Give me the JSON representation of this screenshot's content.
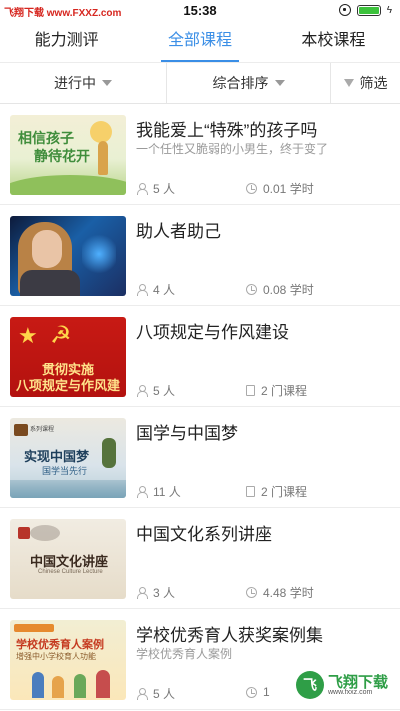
{
  "status_bar": {
    "watermark": "飞翔下载 www.FXXZ.com",
    "time": "15:38"
  },
  "tabs": [
    {
      "label": "能力测评",
      "active": false
    },
    {
      "label": "全部课程",
      "active": true
    },
    {
      "label": "本校课程",
      "active": false
    }
  ],
  "filters": {
    "status": "进行中",
    "sort": "综合排序",
    "filter": "筛选"
  },
  "courses": [
    {
      "title": "我能爱上“特殊”的孩子吗",
      "subtitle": "一个任性又脆弱的小男生，终于变了",
      "people": "5 人",
      "right_icon": "clock-icon",
      "right_text": "0.01 学时",
      "thumb_text": [
        "相信孩子",
        "静待花开"
      ]
    },
    {
      "title": "助人者助己",
      "subtitle": "",
      "people": "4 人",
      "right_icon": "clock-icon",
      "right_text": "0.08 学时"
    },
    {
      "title": "八项规定与作风建设",
      "subtitle": "",
      "people": "5 人",
      "right_icon": "book-icon",
      "right_text": "2 门课程",
      "thumb_text": [
        "贯彻实施",
        "八项规定与作风建设"
      ]
    },
    {
      "title": "国学与中国梦",
      "subtitle": "",
      "people": "11 人",
      "right_icon": "book-icon",
      "right_text": "2 门课程",
      "thumb_text": [
        "系列课程",
        "实现中国梦",
        "国学当先行"
      ]
    },
    {
      "title": "中国文化系列讲座",
      "subtitle": "",
      "people": "3 人",
      "right_icon": "clock-icon",
      "right_text": "4.48 学时",
      "thumb_text": [
        "中国文化讲座",
        "Chinese Culture Lecture"
      ]
    },
    {
      "title": "学校优秀育人获奖案例集",
      "subtitle": "学校优秀育人案例",
      "people": "5 人",
      "right_icon": "clock-icon",
      "right_text": "1",
      "thumb_text": [
        "学校优秀育人案例",
        "增强中小学校育人功能"
      ]
    }
  ],
  "watermark": {
    "logo": "飞",
    "name": "飞翔下载",
    "url": "www.fxxz.com"
  },
  "colors": {
    "accent": "#3a8ee6",
    "watermark_red": "#d6261f",
    "watermark_green": "#2f9e47"
  }
}
